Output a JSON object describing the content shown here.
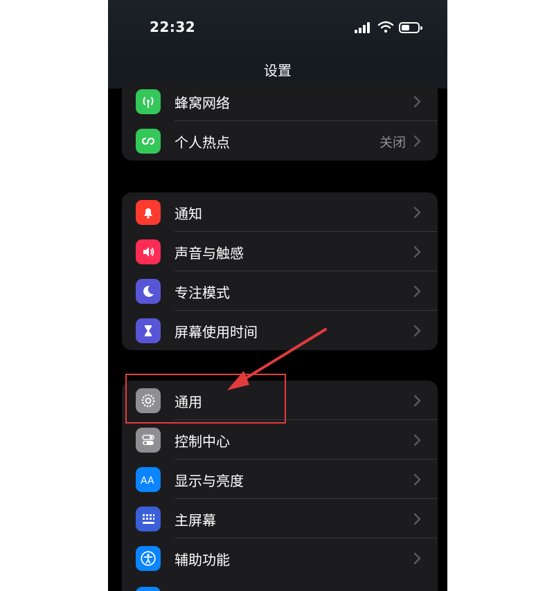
{
  "status_bar": {
    "time": "22:32"
  },
  "nav": {
    "title": "设置"
  },
  "groups": [
    {
      "items": [
        {
          "label": "蜂窝网络",
          "value": "",
          "icon": "cellular-icon",
          "color": "#34c759"
        },
        {
          "label": "个人热点",
          "value": "关闭",
          "icon": "hotspot-icon",
          "color": "#34c759"
        }
      ]
    },
    {
      "items": [
        {
          "label": "通知",
          "value": "",
          "icon": "bell-icon",
          "color": "#ff3b30"
        },
        {
          "label": "声音与触感",
          "value": "",
          "icon": "speaker-icon",
          "color": "#ff2d55"
        },
        {
          "label": "专注模式",
          "value": "",
          "icon": "moon-icon",
          "color": "#5856d6"
        },
        {
          "label": "屏幕使用时间",
          "value": "",
          "icon": "hourglass-icon",
          "color": "#5856d6"
        }
      ]
    },
    {
      "items": [
        {
          "label": "通用",
          "value": "",
          "icon": "gear-icon",
          "color": "#8e8e93"
        },
        {
          "label": "控制中心",
          "value": "",
          "icon": "toggle-icon",
          "color": "#8e8e93"
        },
        {
          "label": "显示与亮度",
          "value": "",
          "icon": "display-aa-icon",
          "color": "#0a84ff"
        },
        {
          "label": "主屏幕",
          "value": "",
          "icon": "home-grid-icon",
          "color": "#3a5fd9"
        },
        {
          "label": "辅助功能",
          "value": "",
          "icon": "accessibility-icon",
          "color": "#0a84ff"
        }
      ]
    }
  ],
  "annotation": {
    "color": "#e23b3b",
    "target": "通用"
  }
}
